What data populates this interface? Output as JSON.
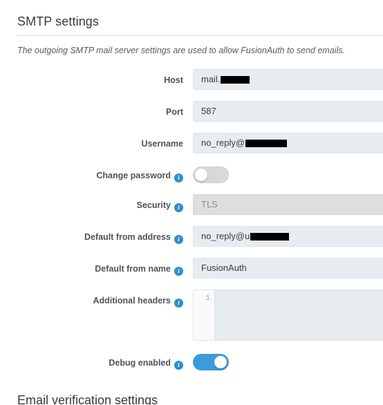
{
  "section": {
    "title": "SMTP settings",
    "description": "The outgoing SMTP mail server settings are used to allow FusionAuth to send emails."
  },
  "icons": {
    "info": "i"
  },
  "colors": {
    "accent": "#3b9cd9",
    "info_icon": "#2e8fce",
    "input_bg": "#e7ecf1",
    "disabled_bg": "#dedede",
    "heading": "#343a40",
    "label": "#4e5357",
    "redaction": "#000000"
  },
  "fields": {
    "host": {
      "label": "Host",
      "value": "mail.",
      "redacted_width": 42,
      "has_info": false
    },
    "port": {
      "label": "Port",
      "value": "587",
      "has_info": false
    },
    "username": {
      "label": "Username",
      "value": "no_reply@",
      "redacted_width": 60,
      "has_info": false
    },
    "change_password": {
      "label": "Change password",
      "state": "off",
      "has_info": true
    },
    "security": {
      "label": "Security",
      "value": "TLS",
      "has_info": true,
      "disabled": true
    },
    "default_from_address": {
      "label": "Default from address",
      "value": "no_reply@u",
      "redacted_width": 56,
      "has_info": true
    },
    "default_from_name": {
      "label": "Default from name",
      "value": "FusionAuth",
      "has_info": true
    },
    "additional_headers": {
      "label": "Additional headers",
      "line_number": "1",
      "value": "",
      "has_info": true
    },
    "debug_enabled": {
      "label": "Debug enabled",
      "state": "on",
      "has_info": true
    }
  },
  "next_section": {
    "title": "Email verification settings"
  }
}
